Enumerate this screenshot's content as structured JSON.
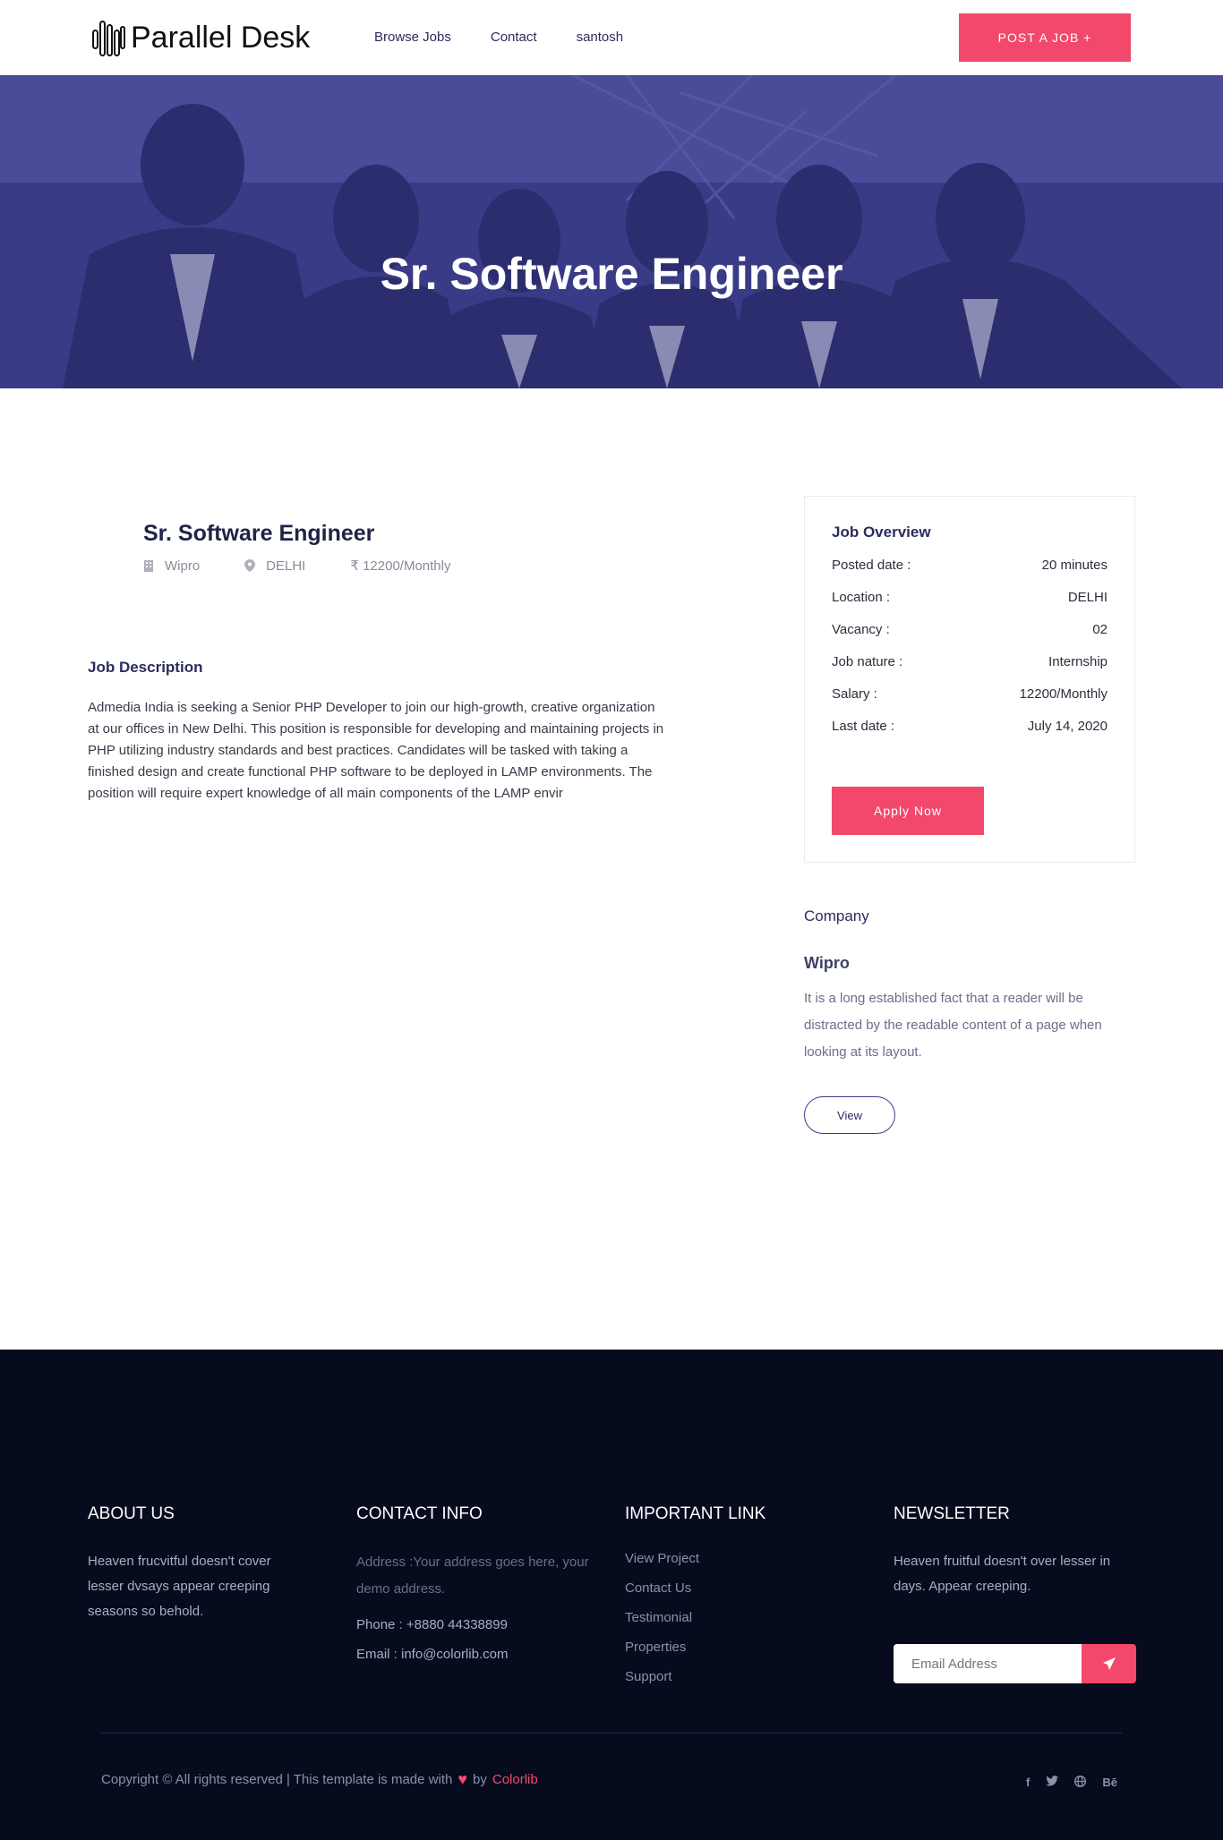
{
  "header": {
    "logo_text": "Parallel Desk",
    "nav": [
      "Browse Jobs",
      "Contact",
      "santosh"
    ],
    "post_job_label": "POST A JOB +"
  },
  "hero": {
    "title": "Sr. Software Engineer"
  },
  "job": {
    "title": "Sr. Software Engineer",
    "company": "Wipro",
    "location": "DELHI",
    "salary": "₹ 12200/Monthly"
  },
  "description": {
    "heading": "Job Description",
    "text": "Admedia India is seeking a Senior PHP Developer to join our high-growth, creative organization at our offices in New Delhi. This position is responsible for developing and maintaining projects in PHP utilizing industry standards and best practices. Candidates will be tasked with taking a finished design and create functional PHP software to be deployed in LAMP environments. The position will require expert knowledge of all main components of the LAMP envir"
  },
  "overview": {
    "title": "Job Overview",
    "rows": [
      {
        "label": "Posted date :",
        "value": "20 minutes"
      },
      {
        "label": "Location :",
        "value": "DELHI"
      },
      {
        "label": "Vacancy :",
        "value": "02"
      },
      {
        "label": "Job nature :",
        "value": "Internship"
      },
      {
        "label": "Salary :",
        "value": "12200/Monthly"
      },
      {
        "label": "Last date :",
        "value": "July 14, 2020"
      }
    ],
    "apply_label": "Apply Now"
  },
  "company": {
    "heading": "Company",
    "name": "Wipro",
    "about": "It is a long established fact that a reader will be distracted by the readable content of a page when looking at its layout.",
    "view_label": "View"
  },
  "footer": {
    "about": {
      "title": "ABOUT US",
      "text": "Heaven frucvitful doesn't cover lesser dvsays appear creeping seasons so behold."
    },
    "contact": {
      "title": "CONTACT INFO",
      "address": "Address :Your address goes here, your demo address.",
      "phone": "Phone : +8880 44338899",
      "email": "Email : info@colorlib.com"
    },
    "links": {
      "title": "IMPORTANT LINK",
      "items": [
        "View Project",
        "Contact Us",
        "Testimonial",
        "Properties",
        "Support"
      ]
    },
    "newsletter": {
      "title": "NEWSLETTER",
      "text": "Heaven fruitful doesn't over lesser in days. Appear creeping.",
      "placeholder": "Email Address"
    },
    "copyright_prefix": "Copyright © All rights reserved | This template is made with",
    "copyright_by": "by",
    "copyright_brand": "Colorlib",
    "socials": [
      "f",
      "twitter",
      "globe",
      "Bē"
    ]
  },
  "colors": {
    "accent": "#f2486b",
    "navy": "#2b2c5e",
    "footer_bg": "#070b1e",
    "hero_overlay": "#3b3b8a"
  }
}
